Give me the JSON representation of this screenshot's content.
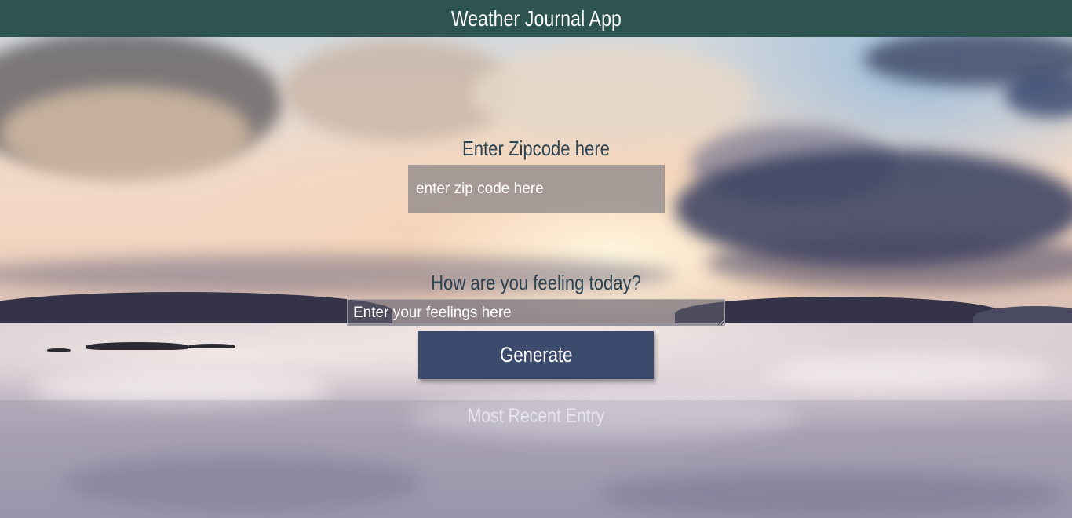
{
  "header": {
    "title": "Weather Journal App"
  },
  "form": {
    "zip_label": "Enter Zipcode here",
    "zip_placeholder": "enter zip code here",
    "zip_value": "",
    "feelings_label": "How are you feeling today?",
    "feelings_placeholder": "Enter your feelings here",
    "feelings_value": "",
    "generate_label": "Generate"
  },
  "entry": {
    "title": "Most Recent Entry"
  },
  "colors": {
    "header_bg": "#2d5450",
    "button_bg": "#3c4a6d",
    "label_text": "#2d4452"
  }
}
